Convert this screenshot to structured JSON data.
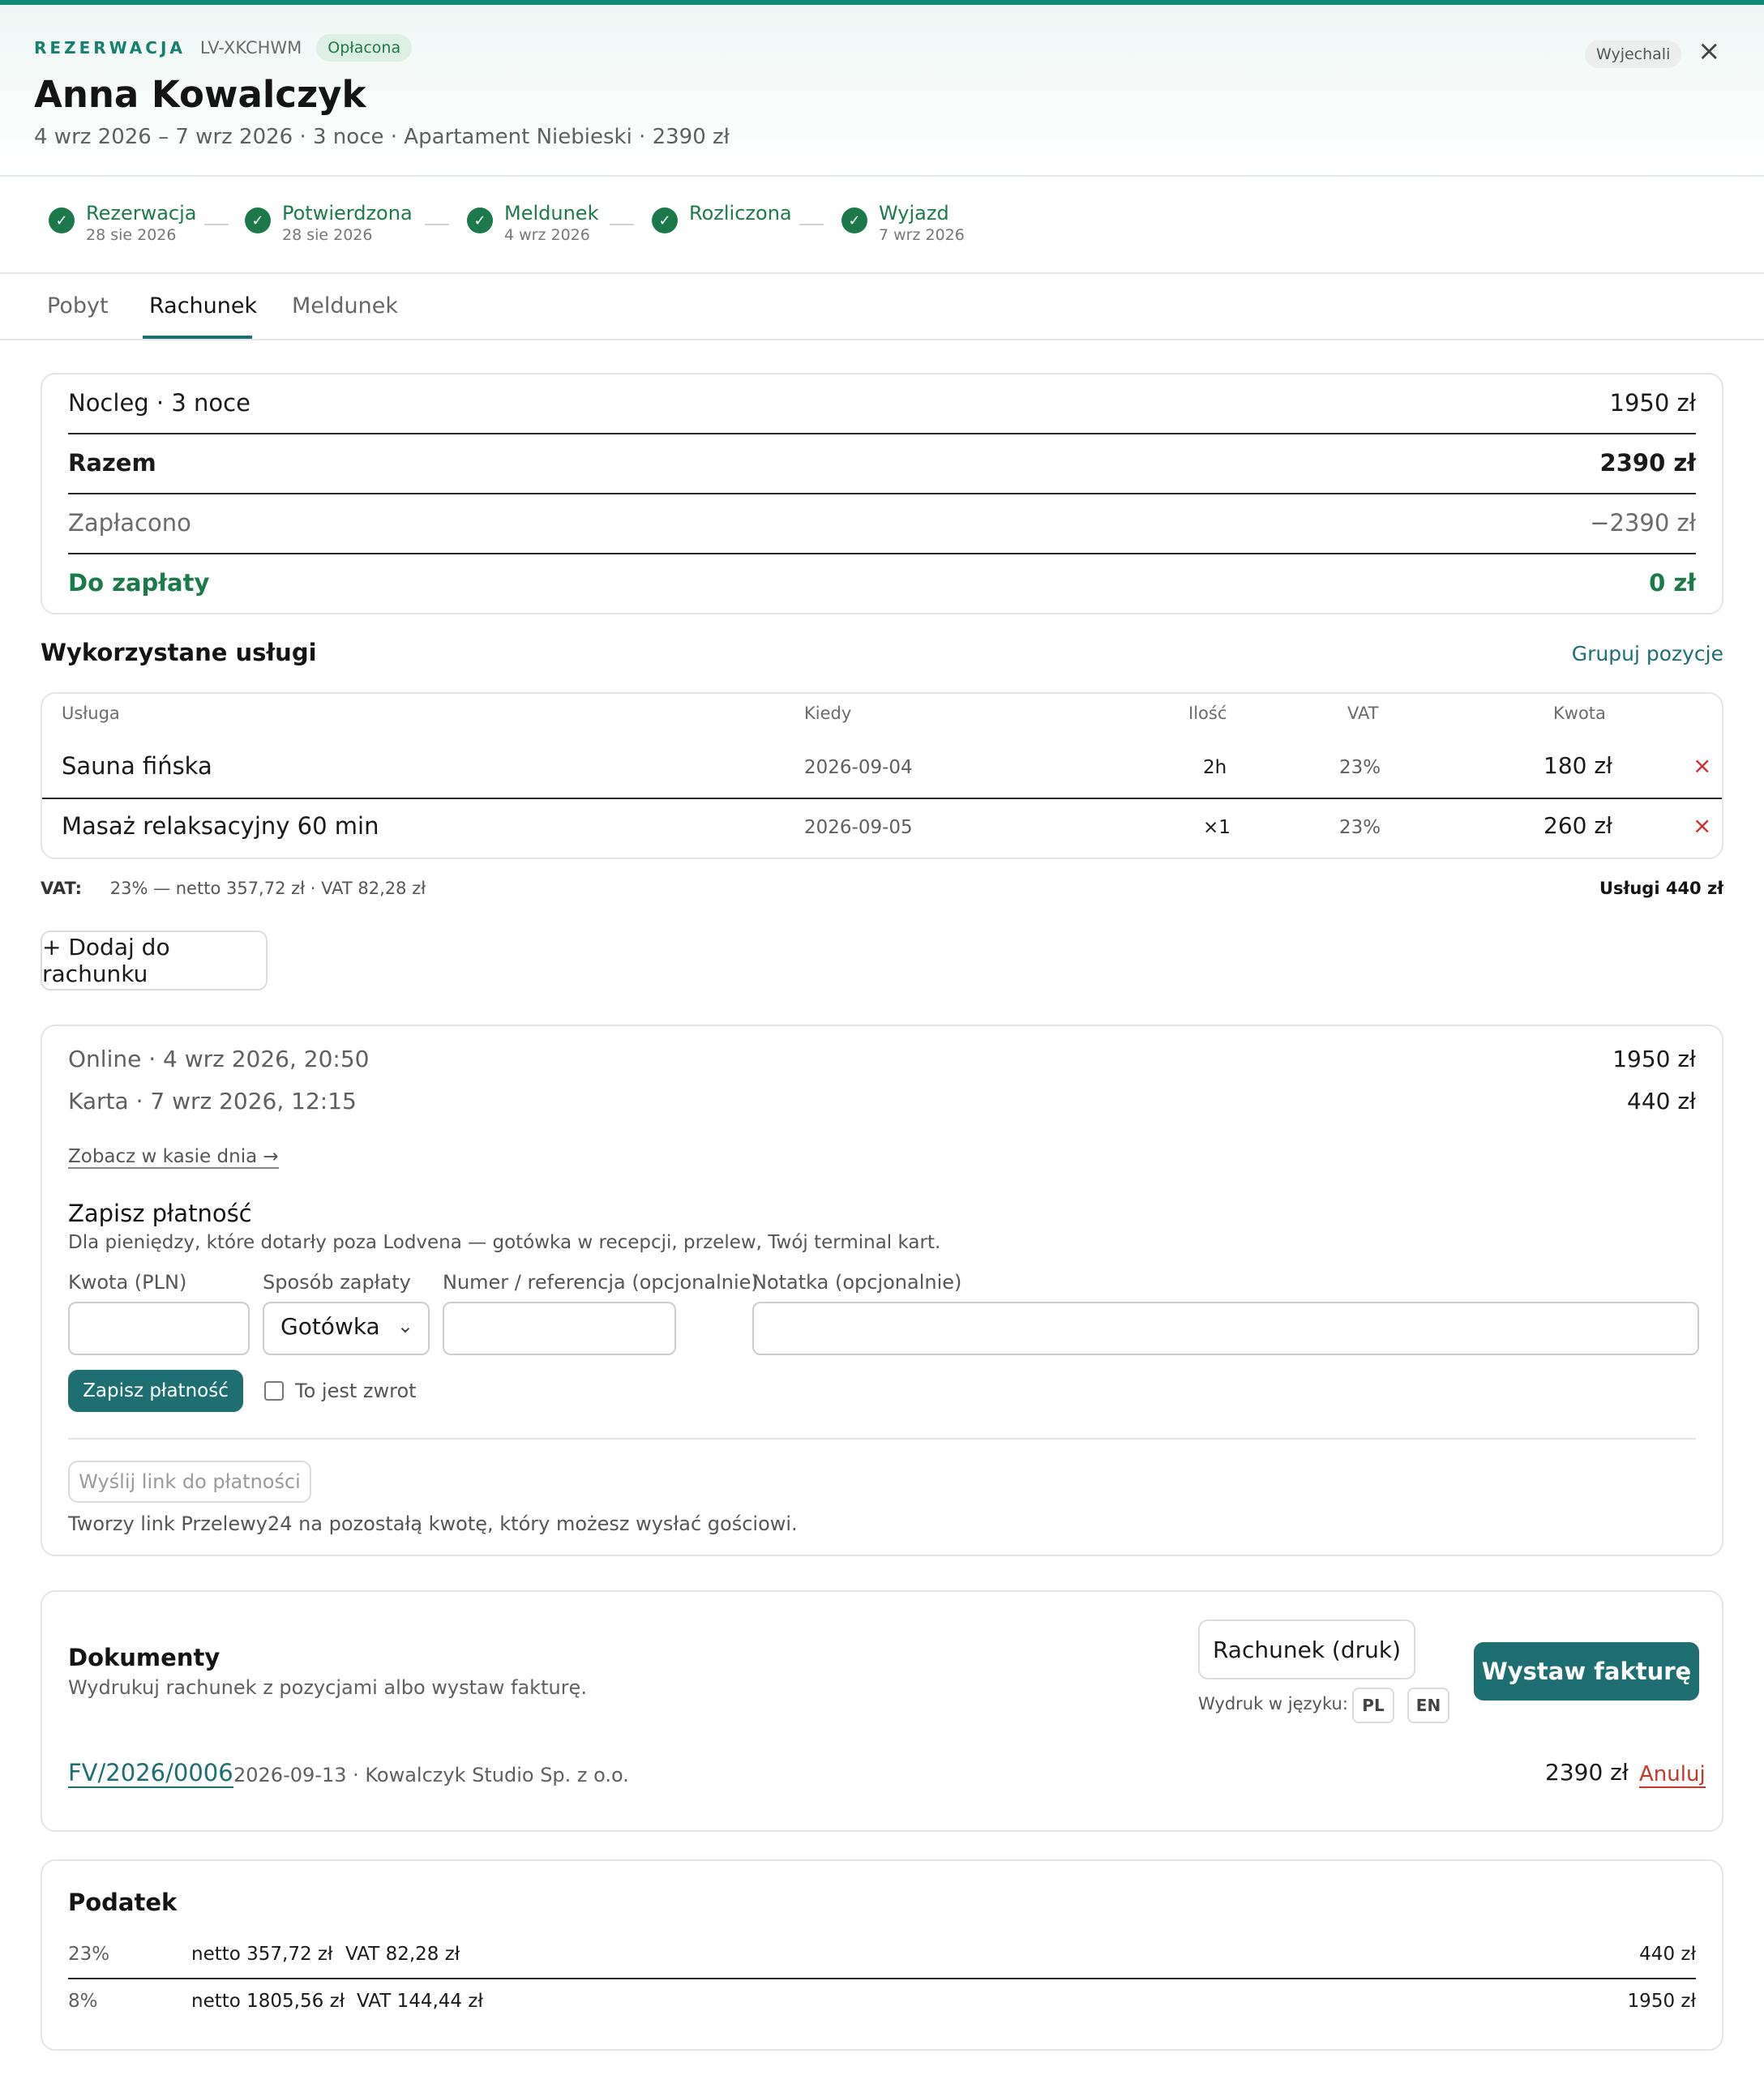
{
  "header": {
    "eyebrow": "REZERWACJA",
    "reference": "LV-XKCHWM",
    "payment_badge": "Opłacona",
    "guest_name": "Anna Kowalczyk",
    "summary": "4 wrz 2026 – 7 wrz 2026 · 3 noce · Apartament Niebieski · 2390 zł",
    "status_badge": "Wyjechali",
    "close_icon": "×"
  },
  "timeline": [
    {
      "label": "Rezerwacja",
      "date": "28 sie 2026"
    },
    {
      "label": "Potwierdzona",
      "date": "28 sie 2026"
    },
    {
      "label": "Meldunek",
      "date": "4 wrz 2026"
    },
    {
      "label": "Rozliczona",
      "date": ""
    },
    {
      "label": "Wyjazd",
      "date": "7 wrz 2026"
    }
  ],
  "tabs": [
    "Pobyt",
    "Rachunek",
    "Meldunek"
  ],
  "active_tab": "Rachunek",
  "summary_card": {
    "lodging_label": "Nocleg · 3 noce",
    "lodging_value": "1950 zł",
    "total_label": "Razem",
    "total_value": "2390 zł",
    "paid_label": "Zapłacono",
    "paid_value": "−2390 zł",
    "due_label": "Do zapłaty",
    "due_value": "0 zł"
  },
  "services": {
    "title": "Wykorzystane usługi",
    "group_link": "Grupuj pozycje",
    "columns": [
      "Usługa",
      "Kiedy",
      "Ilość",
      "VAT",
      "Kwota"
    ],
    "rows": [
      {
        "name": "Sauna fińska",
        "when": "2026-09-04",
        "qty": "2h",
        "vat": "23%",
        "amount": "180 zł"
      },
      {
        "name": "Masaż relaksacyjny 60 min",
        "when": "2026-09-05",
        "qty": "×1",
        "vat": "23%",
        "amount": "260 zł"
      }
    ],
    "vat_label": "VAT:",
    "vat_summary": "23% — netto 357,72 zł · VAT 82,28 zł",
    "services_total": "Usługi 440 zł",
    "add_button": "+ Dodaj do rachunku"
  },
  "payments": {
    "entries": [
      {
        "label": "Online · 4 wrz 2026, 20:50",
        "amount": "1950 zł"
      },
      {
        "label": "Karta · 7 wrz 2026, 12:15",
        "amount": "440 zł"
      }
    ],
    "cash_link": "Zobacz w kasie dnia →",
    "record_title": "Zapisz płatność",
    "record_desc": "Dla pieniędzy, które dotarły poza Lodvena — gotówka w recepcji, przelew, Twój terminal kart.",
    "amount_label": "Kwota (PLN)",
    "method_label": "Sposób zapłaty",
    "method_value": "Gotówka",
    "ref_label": "Numer / referencja (opcjonalnie)",
    "note_label": "Notatka (opcjonalnie)",
    "save_button": "Zapisz płatność",
    "refund_label": "To jest zwrot",
    "send_link_button": "Wyślij link do płatności",
    "send_link_desc": "Tworzy link Przelewy24 na pozostałą kwotę, który możesz wysłać gościowi."
  },
  "documents": {
    "title": "Dokumenty",
    "subtitle": "Wydrukuj rachunek z pozycjami albo wystaw fakturę.",
    "print_button": "Rachunek (druk)",
    "language_label": "Wydruk w języku:",
    "languages": [
      "PL",
      "EN"
    ],
    "invoice_button": "Wystaw fakturę",
    "invoice": {
      "number": "FV/2026/0006",
      "meta": "2026-09-13 · Kowalczyk Studio Sp. z o.o.",
      "amount": "2390 zł",
      "cancel": "Anuluj"
    }
  },
  "tax": {
    "title": "Podatek",
    "rows": [
      {
        "rate": "23%",
        "net": "netto 357,72 zł",
        "vat": "VAT 82,28 zł",
        "total": "440 zł"
      },
      {
        "rate": "8%",
        "net": "netto 1805,56 zł",
        "vat": "VAT 144,44 zł",
        "total": "1950 zł"
      }
    ]
  },
  "colors": {
    "accent": "#1d6f72",
    "success": "#1c7a4a",
    "danger": "#d22a2a"
  }
}
